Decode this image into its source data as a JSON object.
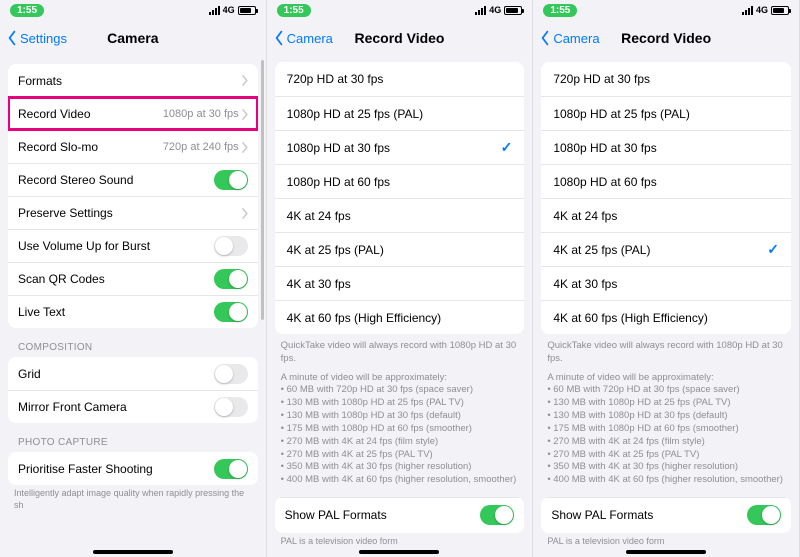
{
  "status": {
    "time": "1:55",
    "network": "4G"
  },
  "pane1": {
    "back": "Settings",
    "title": "Camera",
    "rows": {
      "formats": "Formats",
      "record_video": "Record Video",
      "record_video_detail": "1080p at 30 fps",
      "record_slomo": "Record Slo-mo",
      "record_slomo_detail": "720p at 240 fps",
      "stereo": "Record Stereo Sound",
      "preserve": "Preserve Settings",
      "volburst": "Use Volume Up for Burst",
      "qr": "Scan QR Codes",
      "live": "Live Text"
    },
    "composition_header": "COMPOSITION",
    "composition": {
      "grid": "Grid",
      "mirror": "Mirror Front Camera"
    },
    "photo_header": "PHOTO CAPTURE",
    "photo": {
      "prioritise": "Prioritise Faster Shooting"
    },
    "footer": "Intelligently adapt image quality when rapidly pressing the sh"
  },
  "video": {
    "back": "Camera",
    "title": "Record Video",
    "options": [
      "720p HD at 30 fps",
      "1080p HD at 25 fps (PAL)",
      "1080p HD at 30 fps",
      "1080p HD at 60 fps",
      "4K at 24 fps",
      "4K at 25 fps (PAL)",
      "4K at 30 fps",
      "4K at 60 fps (High Efficiency)"
    ],
    "quicktake": "QuickTake video will always record with 1080p HD at 30 fps.",
    "minute_intro": "A minute of video will be approximately:",
    "bullets": [
      "60 MB with 720p HD at 30 fps (space saver)",
      "130 MB with 1080p HD at 25 fps (PAL TV)",
      "130 MB with 1080p HD at 30 fps (default)",
      "175 MB with 1080p HD at 60 fps (smoother)",
      "270 MB with 4K at 24 fps (film style)",
      "270 MB with 4K at 25 fps (PAL TV)",
      "350 MB with 4K at 30 fps (higher resolution)",
      "400 MB with 4K at 60 fps (higher resolution, smoother)"
    ],
    "pal_label": "Show PAL Formats",
    "pal_footer": "PAL is a television video form"
  },
  "pane2_selected_index": 2,
  "pane3_selected_index": 5
}
